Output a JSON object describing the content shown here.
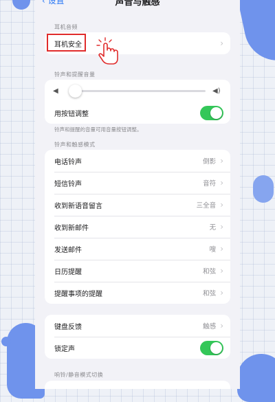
{
  "nav": {
    "back_label": "设置",
    "title": "声音与触感"
  },
  "headphone_section": {
    "header": "耳机音频",
    "item_label": "耳机安全"
  },
  "ringer_section": {
    "header": "铃声和提醒音量",
    "volume_level": 0.04,
    "buttons_label": "用按钮调整",
    "buttons_enabled": true,
    "note": "铃声和提醒的音量可用音量按钮调整。"
  },
  "haptics_section": {
    "header": "铃声和触感模式",
    "items": [
      {
        "label": "电话铃声",
        "value": "倒影"
      },
      {
        "label": "短信铃声",
        "value": "音符"
      },
      {
        "label": "收到新语音留言",
        "value": "三全音"
      },
      {
        "label": "收到新邮件",
        "value": "无"
      },
      {
        "label": "发送邮件",
        "value": "嗖"
      },
      {
        "label": "日历提醒",
        "value": "和弦"
      },
      {
        "label": "提醒事项的提醒",
        "value": "和弦"
      }
    ]
  },
  "feedback_section": {
    "keyboard_label": "键盘反馈",
    "keyboard_value": "触感",
    "lock_label": "锁定声",
    "lock_enabled": true
  },
  "mode_section": {
    "header": "响铃/静音模式切换"
  },
  "colors": {
    "accent_blue": "#2f7bf6",
    "toggle_green": "#34c759",
    "highlight_red": "#e02b2b"
  }
}
